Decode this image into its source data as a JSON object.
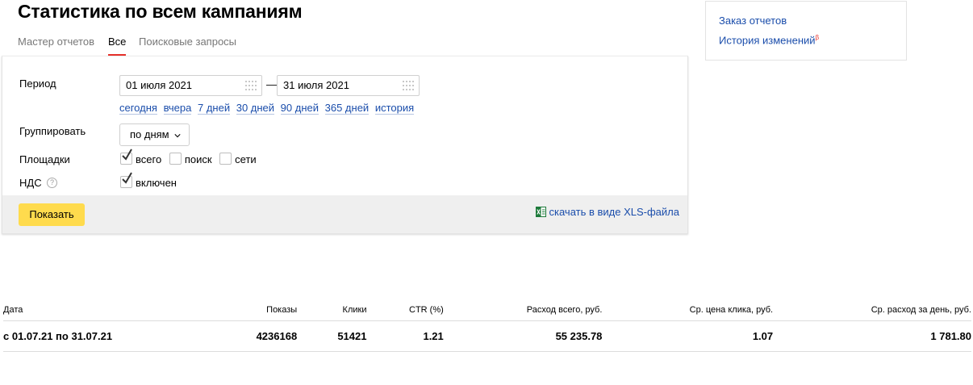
{
  "page": {
    "title": "Статистика по всем кампаниям"
  },
  "tabs": [
    {
      "label": "Мастер отчетов",
      "active": false
    },
    {
      "label": "Все",
      "active": true
    },
    {
      "label": "Поисковые запросы",
      "active": false
    }
  ],
  "form": {
    "period_label": "Период",
    "date_from": "01 июля 2021",
    "date_to": "31 июля 2021",
    "date_separator": "—",
    "presets": [
      "сегодня",
      "вчера",
      "7 дней",
      "30 дней",
      "90 дней",
      "365 дней",
      "история"
    ],
    "group_label": "Группировать",
    "group_value": "по дням",
    "platforms_label": "Площадки",
    "platforms": [
      {
        "label": "всего",
        "checked": true
      },
      {
        "label": "поиск",
        "checked": false
      },
      {
        "label": "сети",
        "checked": false
      }
    ],
    "vat_label": "НДС",
    "vat_help": "?",
    "vat_option": {
      "label": "включен",
      "checked": true
    },
    "show_button": "Показать",
    "xls_link": "скачать в виде XLS-файла"
  },
  "sidebar": {
    "links": [
      {
        "label": "Заказ отчетов"
      },
      {
        "label": "История изменений",
        "badge": "β"
      }
    ]
  },
  "table": {
    "headers": [
      "Дата",
      "Показы",
      "Клики",
      "CTR (%)",
      "Расход всего, руб.",
      "Ср. цена клика, руб.",
      "Ср. расход за день, руб."
    ],
    "rows": [
      [
        "с 01.07.21 по 31.07.21",
        "4236168",
        "51421",
        "1.21",
        "55 235.78",
        "1.07",
        "1 781.80"
      ]
    ]
  },
  "colors": {
    "accent_red": "#e6312b",
    "link_blue": "#1a4dab",
    "button_yellow": "#ffdb4d",
    "checkmark": "#333333",
    "excel_green": "#1d7a3a"
  }
}
